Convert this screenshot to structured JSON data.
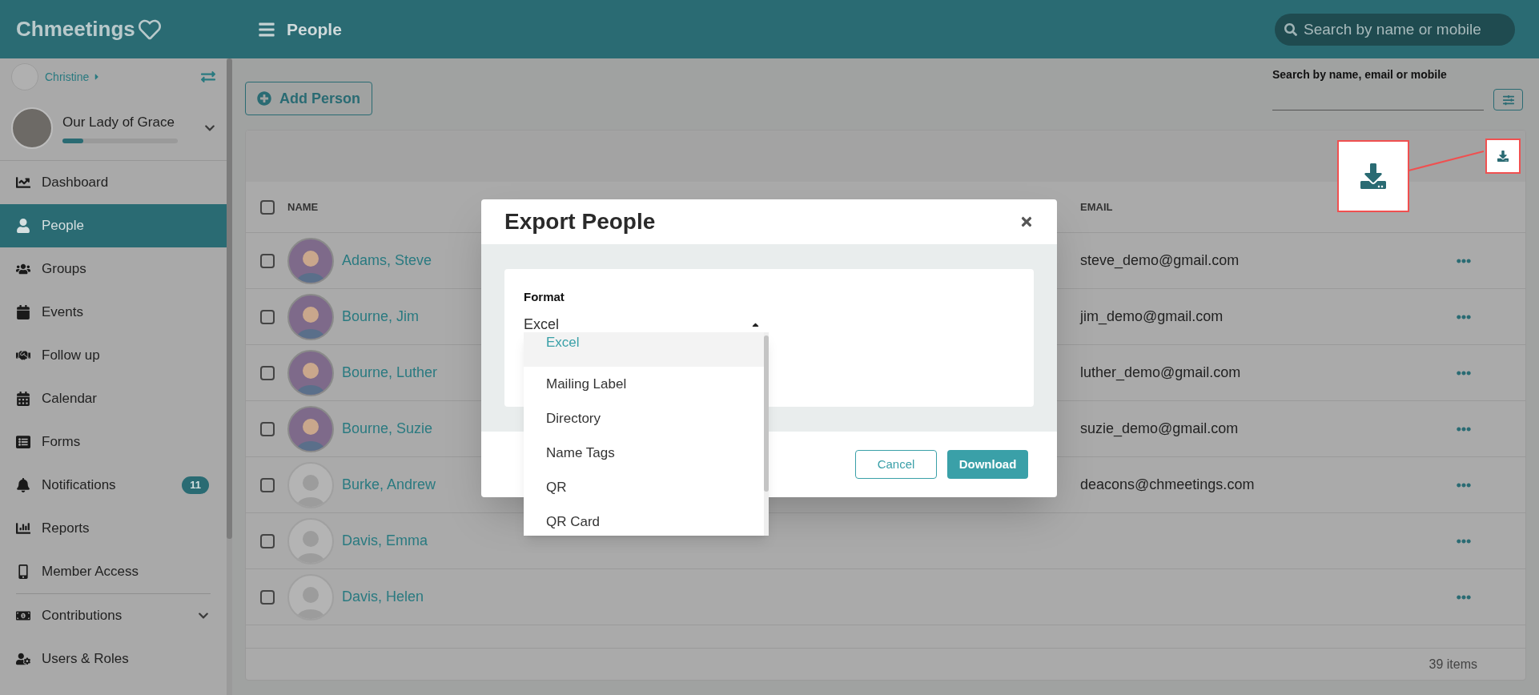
{
  "topbar": {
    "logo": "Chmeetings",
    "page_title": "People",
    "search": {
      "placeholder": "Search by name or mobile"
    }
  },
  "sidebar": {
    "user": "Christine",
    "organization": {
      "name": "Our Lady of Grace",
      "level": 0.18
    },
    "items": [
      {
        "label": "Dashboard",
        "selected": false
      },
      {
        "label": "People",
        "selected": true
      },
      {
        "label": "Groups",
        "selected": false
      },
      {
        "label": "Events",
        "selected": false
      },
      {
        "label": "Follow up",
        "selected": false
      },
      {
        "label": "Calendar",
        "selected": false
      },
      {
        "label": "Forms",
        "selected": false
      },
      {
        "label": "Notifications",
        "selected": false,
        "badge": "11"
      },
      {
        "label": "Reports",
        "selected": false
      },
      {
        "label": "Member Access",
        "selected": false
      },
      {
        "label": "Contributions",
        "selected": false,
        "expandable": true
      },
      {
        "label": "Users & Roles",
        "selected": false
      }
    ]
  },
  "toolbar": {
    "add_button": "Add Person",
    "search": {
      "label": "Search by name, email or mobile"
    }
  },
  "table": {
    "columns": [
      "NAME",
      "EMAIL"
    ],
    "select_all_checked": false,
    "rows": [
      {
        "name": "Adams, Steve",
        "email": "steve_demo@gmail.com",
        "has_photo": true,
        "checked": false
      },
      {
        "name": "Bourne, Jim",
        "email": "jim_demo@gmail.com",
        "has_photo": true,
        "checked": false
      },
      {
        "name": "Bourne, Luther",
        "email": "luther_demo@gmail.com",
        "has_photo": true,
        "checked": false
      },
      {
        "name": "Bourne, Suzie",
        "email": "suzie_demo@gmail.com",
        "has_photo": true,
        "checked": false
      },
      {
        "name": "Burke, Andrew",
        "email": "deacons@chmeetings.com",
        "has_photo": false,
        "checked": false
      },
      {
        "name": "Davis, Emma",
        "has_photo": false,
        "checked": false
      },
      {
        "name": "Davis, Helen",
        "has_photo": false,
        "checked": false
      }
    ],
    "footer": "39 items"
  },
  "modal": {
    "title": "Export People",
    "field_label": "Format",
    "value": "Excel",
    "options": [
      {
        "label": "Excel",
        "selected": true
      },
      {
        "label": "Mailing Label",
        "selected": false
      },
      {
        "label": "Directory",
        "selected": false
      },
      {
        "label": "Name Tags",
        "selected": false
      },
      {
        "label": "QR",
        "selected": false
      },
      {
        "label": "QR Card",
        "selected": false
      }
    ],
    "buttons": [
      "Cancel",
      "Download"
    ]
  }
}
